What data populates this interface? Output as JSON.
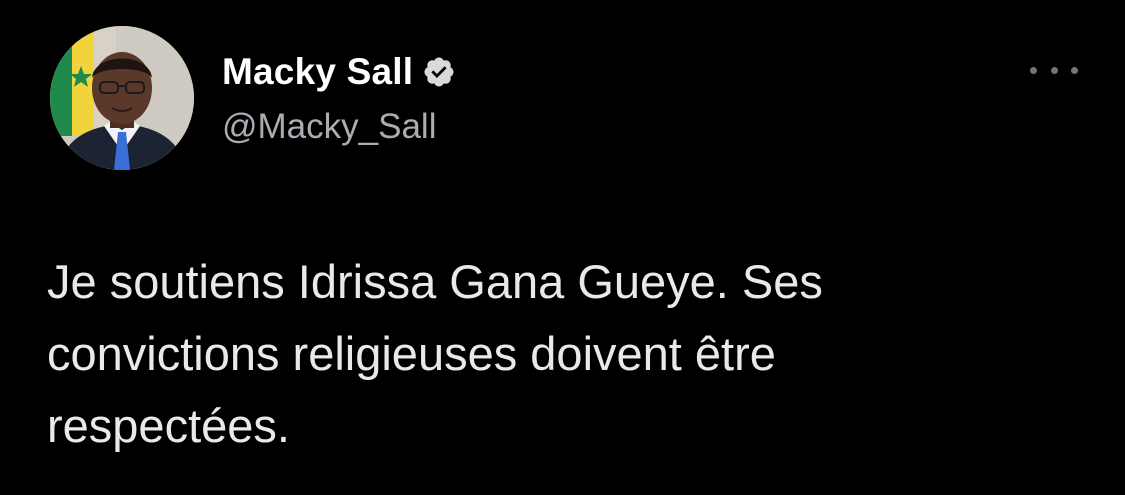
{
  "tweet": {
    "author": {
      "display_name": "Macky Sall",
      "handle": "@Macky_Sall",
      "verified": true,
      "avatar_icon": "profile-photo-icon"
    },
    "more_icon": "more-horizontal-icon",
    "text": "Je soutiens Idrissa Gana Gueye. Ses\nconvictions religieuses doivent être\nrespectées."
  },
  "colors": {
    "background": "#000000",
    "text": "#e7e9ea",
    "secondary_text": "#a8adb2",
    "verified_badge": "#d9d9d9"
  }
}
